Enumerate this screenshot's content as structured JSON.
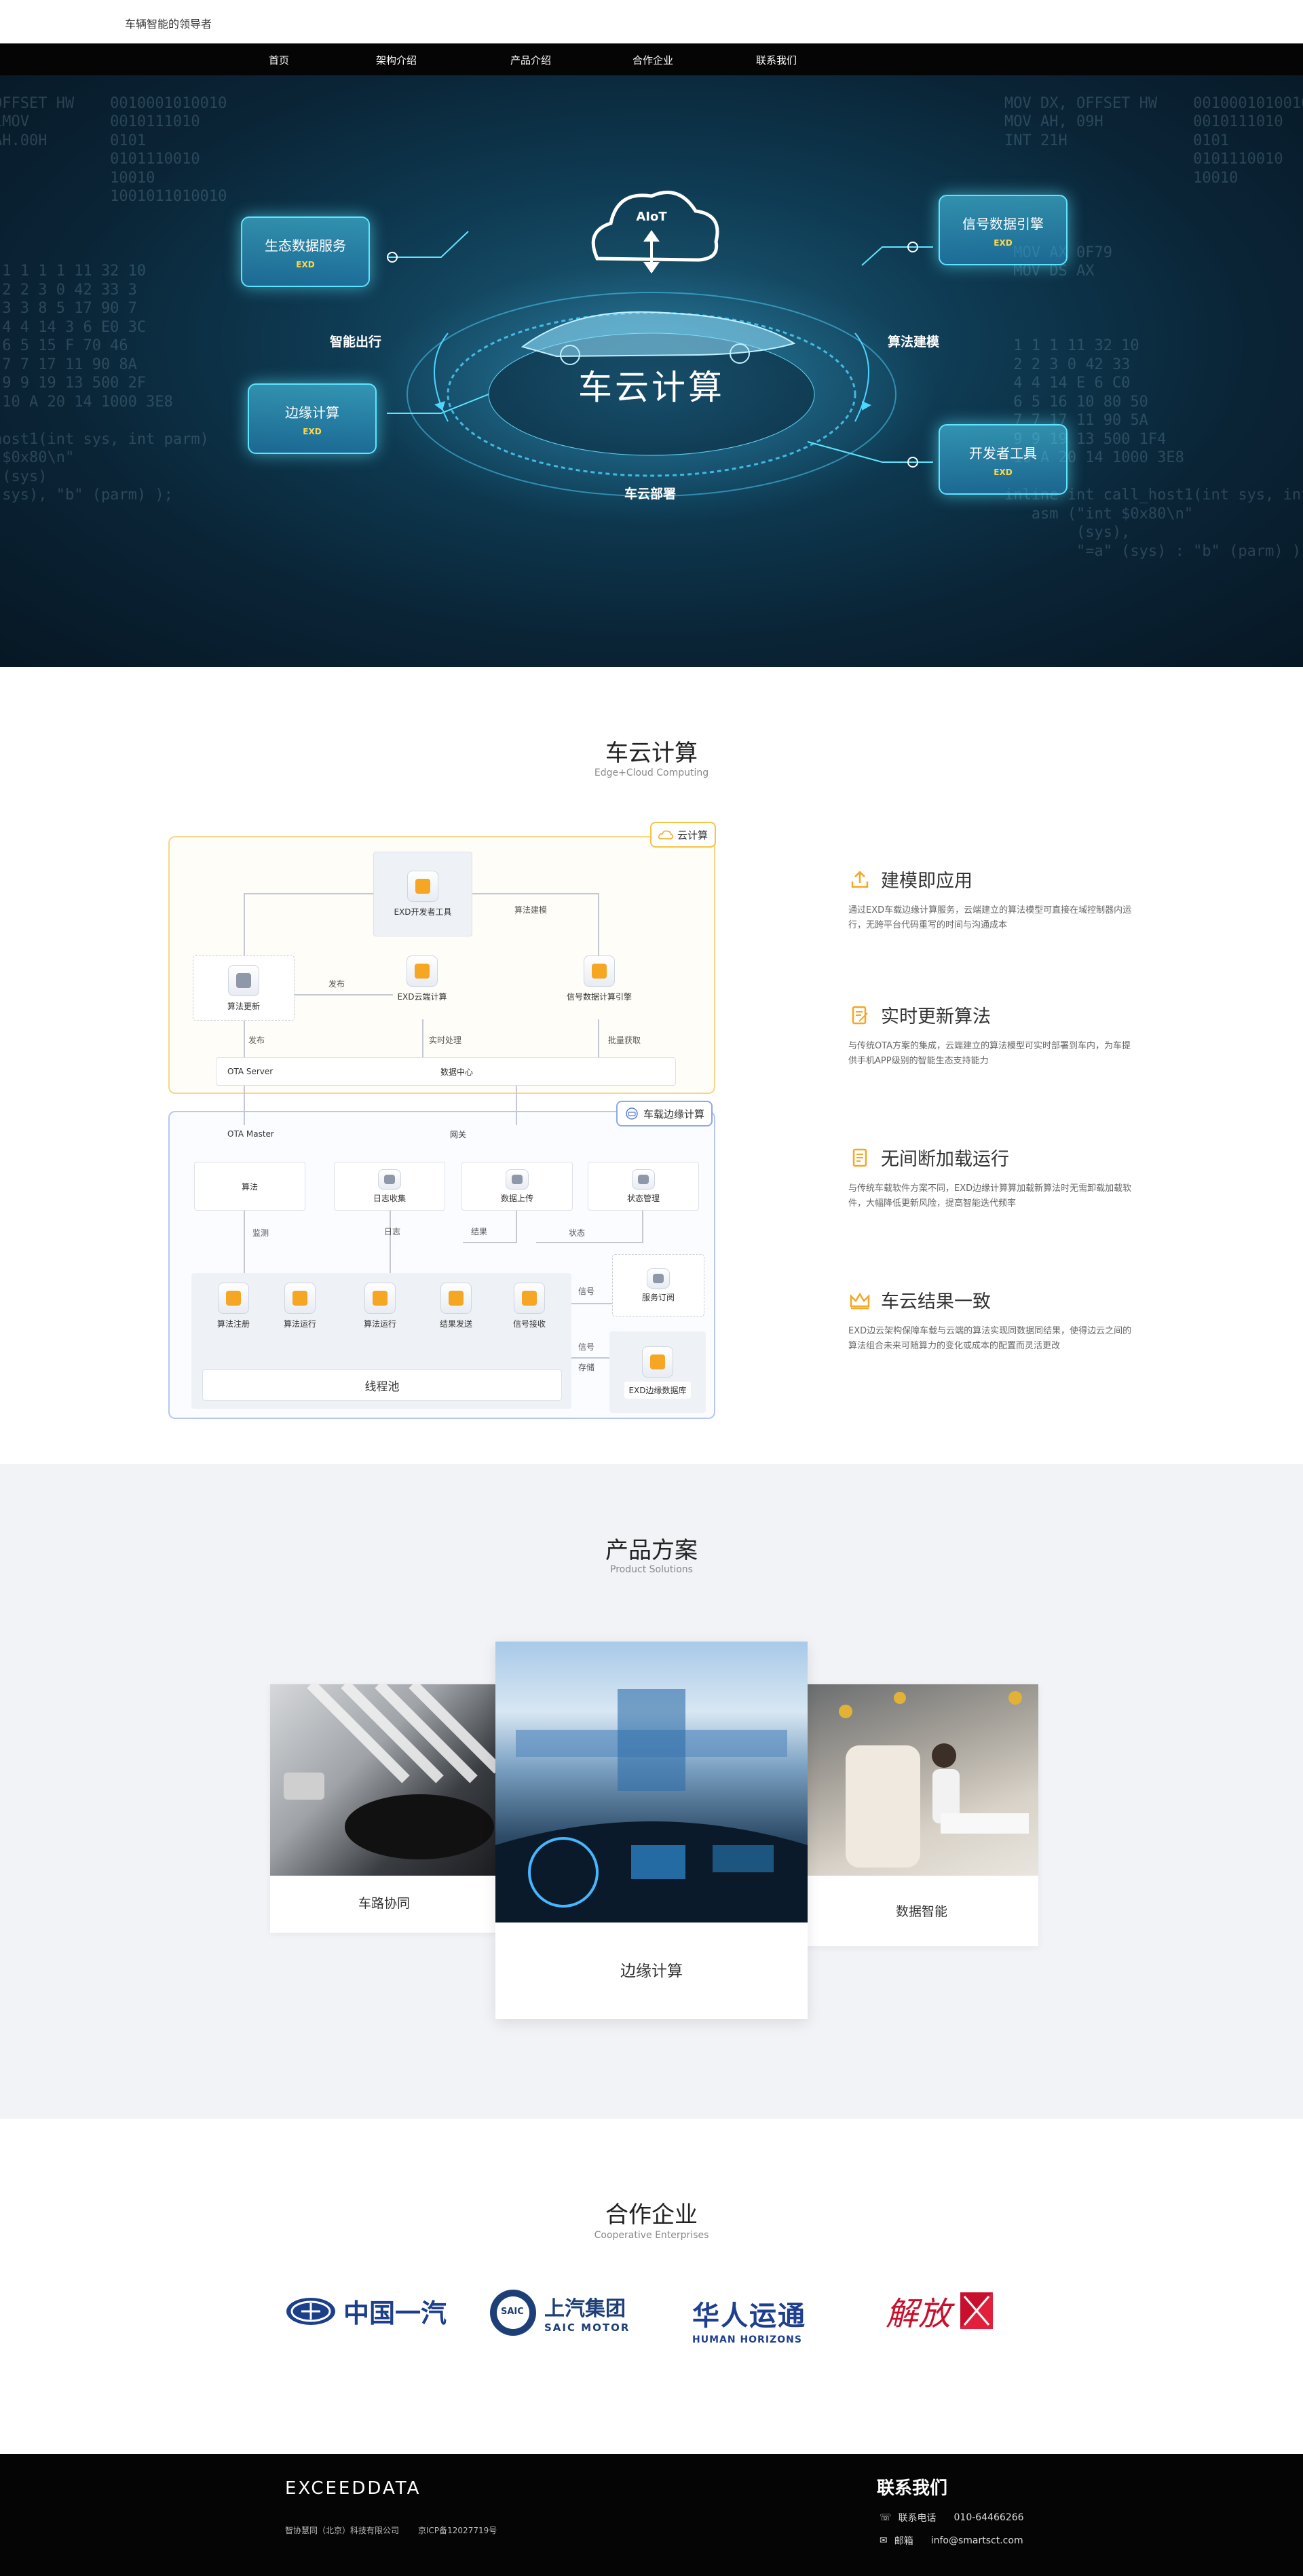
{
  "header": {
    "tagline": "车辆智能的领导者"
  },
  "nav": {
    "items": [
      "首页",
      "架构介绍",
      "产品介绍",
      "合作企业",
      "联系我们"
    ]
  },
  "hero": {
    "boxes": [
      {
        "title": "生态数据服务",
        "sub": "EXD"
      },
      {
        "title": "边缘计算",
        "sub": "EXD"
      },
      {
        "title": "信号数据引擎",
        "sub": "EXD"
      },
      {
        "title": "开发者工具",
        "sub": "EXD"
      }
    ],
    "labels": {
      "left": "智能出行",
      "right": "算法建模",
      "bottom": "车云部署"
    },
    "cloud_label": "AIoT",
    "title": "车云计算"
  },
  "architecture": {
    "title": "车云计算",
    "subtitle": "Edge+Cloud Computing",
    "diagram": {
      "cloud_tag": "云计算",
      "vehicle_tag": "车载边缘计算",
      "dev_tool": "EXD开发者工具",
      "algo_update": "算法更新",
      "cloud_compute": "EXD云端计算",
      "signal_engine": "信号数据计算引擎",
      "label_modeling": "算法建模",
      "label_publish": "发布",
      "label_publish2": "发布",
      "label_realtime": "实时处理",
      "label_batch": "批量获取",
      "ota_server": "OTA  Server",
      "data_center": "数据中心",
      "ota_master": "OTA  Master",
      "gateway": "网关",
      "algorithm": "算法",
      "log_collect": "日志收集",
      "data_upload": "数据上传",
      "status_mgmt": "状态管理",
      "label_monitor": "监测",
      "label_log": "日志",
      "label_result": "结果",
      "label_status": "状态",
      "label_signal": "信号",
      "label_signal2": "信号",
      "label_store": "存储",
      "service_sub": "服务订阅",
      "pool_items": [
        "算法注册",
        "算法运行",
        "算法运行",
        "结果发送",
        "信号接收"
      ],
      "thread_pool": "线程池",
      "edge_db": "EXD边缘数据库"
    },
    "features": [
      {
        "title": "建模即应用",
        "desc": "通过EXD车载边缘计算服务，云端建立的算法模型可直接在域控制器内运行，无跨平台代码重写的时间与沟通成本",
        "icon": "upload-icon"
      },
      {
        "title": "实时更新算法",
        "desc": "与传统OTA方案的集成，云端建立的算法模型可实时部署到车内，为车提供手机APP级别的智能生态支持能力",
        "icon": "document-edit-icon"
      },
      {
        "title": "无间断加载运行",
        "desc": "与传统车载软件方案不同，EXD边缘计算算加载新算法时无需卸载加载软件，大幅降低更新风险，提高智能迭代频率",
        "icon": "document-icon"
      },
      {
        "title": "车云结果一致",
        "desc": "EXD边云架构保障车载与云端的算法实现同数据同结果，使得边云之间的算法组合未来可随算力的变化或成本的配置而灵活更改",
        "icon": "crown-icon"
      }
    ]
  },
  "products": {
    "title": "产品方案",
    "subtitle": "Product Solutions",
    "cards": [
      {
        "label": "车路协同"
      },
      {
        "label": "边缘计算"
      },
      {
        "label": "数据智能"
      }
    ]
  },
  "partners": {
    "title": "合作企业",
    "subtitle": "Cooperative Enterprises",
    "logos": [
      {
        "name": "中国一汽"
      },
      {
        "name": "上汽集团",
        "sub": "SAIC MOTOR",
        "badge": "SAIC"
      },
      {
        "name": "华人运通",
        "sub": "HUMAN HORIZONS"
      },
      {
        "name": "解放"
      }
    ]
  },
  "footer": {
    "logo": "EXCEEDDATA",
    "company": "智协慧同（北京）科技有限公司",
    "icp": "京ICP备12027719号",
    "contact_title": "联系我们",
    "phone_label": "联系电话",
    "phone": "010-64466266",
    "email_label": "邮箱",
    "email": "info@smartsct.com"
  },
  "colors": {
    "accent": "#f5a623",
    "nav_bg": "#050505",
    "cloud_frame": "#f6c343",
    "vehicle_frame": "#8fa8e6"
  }
}
